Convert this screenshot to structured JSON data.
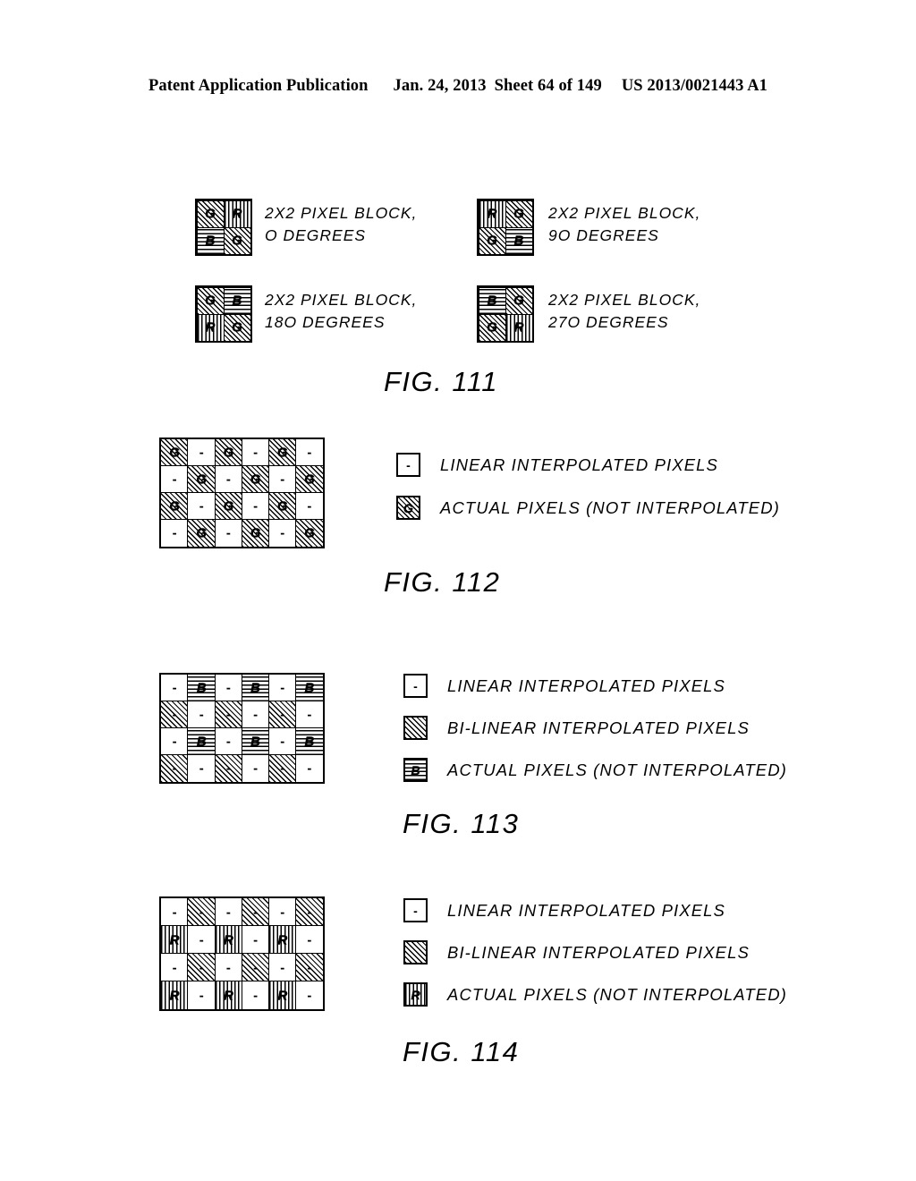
{
  "header": {
    "publication": "Patent Application Publication",
    "date": "Jan. 24, 2013",
    "sheet": "Sheet 64 of 149",
    "number": "US 2013/0021443 A1"
  },
  "patterns": {
    "G": "diagonal-hatch",
    "R": "vertical-stripes",
    "B": "horizontal-stripes",
    "BI": "diagonal-hatch",
    "BLANK": "white"
  },
  "figures": [
    {
      "id": "fig-111",
      "caption": "FIG. 111",
      "blocks": [
        {
          "name": "block-0-degrees",
          "label": "2X2 PIXEL BLOCK,\nO DEGREES",
          "cells": [
            "G",
            "R",
            "B",
            "G"
          ]
        },
        {
          "name": "block-90-degrees",
          "label": "2X2 PIXEL BLOCK,\n9O DEGREES",
          "cells": [
            "R",
            "G",
            "G",
            "B"
          ]
        },
        {
          "name": "block-180-degrees",
          "label": "2X2 PIXEL BLOCK,\n18O DEGREES",
          "cells": [
            "G",
            "B",
            "R",
            "G"
          ]
        },
        {
          "name": "block-270-degrees",
          "label": "2X2 PIXEL BLOCK,\n27O DEGREES",
          "cells": [
            "B",
            "G",
            "G",
            "R"
          ]
        }
      ]
    },
    {
      "id": "fig-112",
      "caption": "FIG. 112",
      "grid": {
        "columns": 6,
        "rows": 4,
        "cells": [
          [
            "G",
            "-",
            "G",
            "-",
            "G",
            "-"
          ],
          [
            "-",
            "G",
            "-",
            "G",
            "-",
            "G"
          ],
          [
            "G",
            "-",
            "G",
            "-",
            "G",
            "-"
          ],
          [
            "-",
            "G",
            "-",
            "G",
            "-",
            "G"
          ]
        ]
      },
      "legend": [
        {
          "swatch": "BLANK",
          "mark": "-",
          "text": "LINEAR INTERPOLATED PIXELS"
        },
        {
          "swatch": "G",
          "mark": "G",
          "text": "ACTUAL PIXELS (NOT INTERPOLATED)"
        }
      ]
    },
    {
      "id": "fig-113",
      "caption": "FIG. 113",
      "grid": {
        "columns": 6,
        "rows": 4,
        "cells": [
          [
            "-",
            "B",
            "-",
            "B",
            "-",
            "B"
          ],
          [
            "BI",
            "-",
            "BI",
            "-",
            "BI",
            "-"
          ],
          [
            "-",
            "B",
            "-",
            "B",
            "-",
            "B"
          ],
          [
            "BI",
            "-",
            "BI",
            "-",
            "BI",
            "-"
          ]
        ]
      },
      "legend": [
        {
          "swatch": "BLANK",
          "mark": "-",
          "text": "LINEAR INTERPOLATED PIXELS"
        },
        {
          "swatch": "BI",
          "mark": "",
          "text": "BI-LINEAR INTERPOLATED PIXELS"
        },
        {
          "swatch": "B",
          "mark": "B",
          "text": "ACTUAL PIXELS (NOT INTERPOLATED)"
        }
      ]
    },
    {
      "id": "fig-114",
      "caption": "FIG. 114",
      "grid": {
        "columns": 6,
        "rows": 4,
        "cells": [
          [
            "-",
            "BI",
            "-",
            "BI",
            "-",
            "BI"
          ],
          [
            "R",
            "-",
            "R",
            "-",
            "R",
            "-"
          ],
          [
            "-",
            "BI",
            "-",
            "BI",
            "-",
            "BI"
          ],
          [
            "R",
            "-",
            "R",
            "-",
            "R",
            "-"
          ]
        ]
      },
      "legend": [
        {
          "swatch": "BLANK",
          "mark": "-",
          "text": "LINEAR INTERPOLATED PIXELS"
        },
        {
          "swatch": "BI",
          "mark": "",
          "text": "BI-LINEAR INTERPOLATED PIXELS"
        },
        {
          "swatch": "R",
          "mark": "R",
          "text": "ACTUAL PIXELS (NOT INTERPOLATED)"
        }
      ]
    }
  ]
}
